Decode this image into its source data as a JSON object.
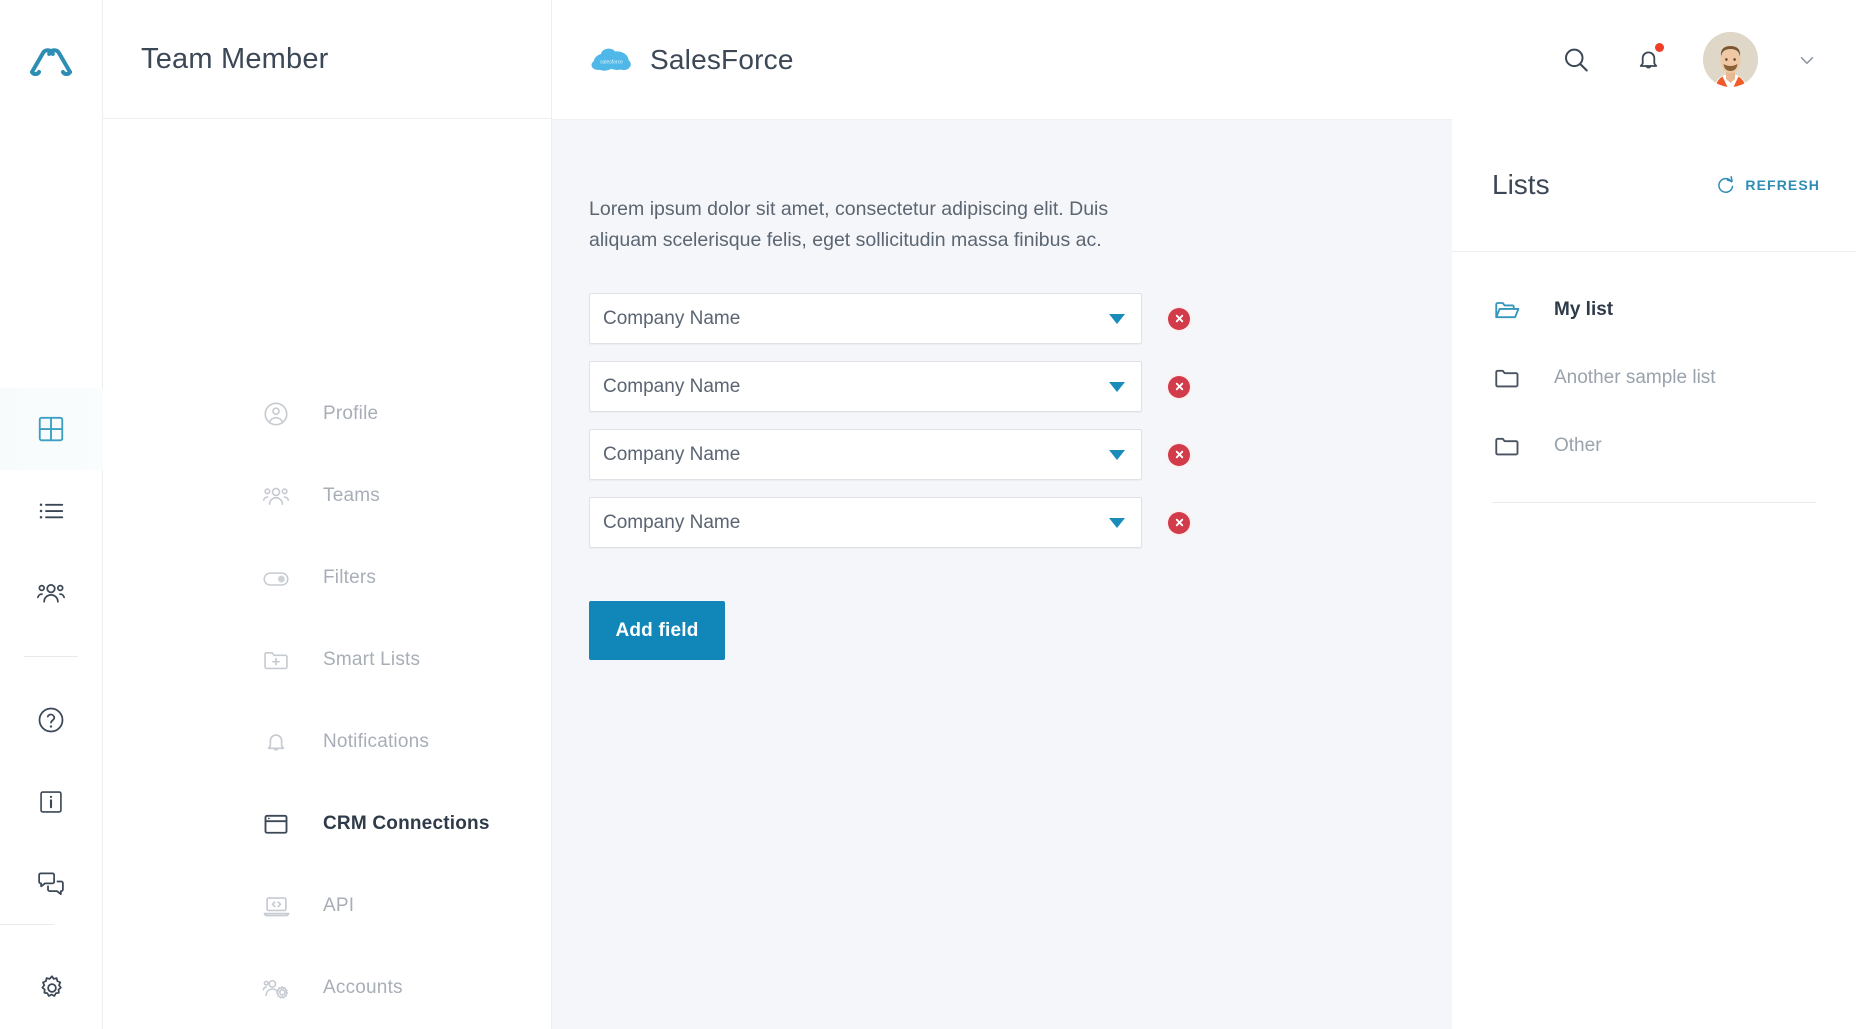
{
  "rail": {
    "logo_icon": "brand-logo-icon",
    "items": [
      {
        "icon": "grid-icon",
        "name": "grid",
        "active": true
      },
      {
        "icon": "list-icon",
        "name": "list",
        "active": false
      },
      {
        "icon": "people-icon",
        "name": "people",
        "active": false
      }
    ],
    "bottom_items": [
      {
        "icon": "help-circle-icon",
        "name": "help",
        "active": false
      },
      {
        "icon": "info-square-icon",
        "name": "info",
        "active": false
      },
      {
        "icon": "chat-bubbles-icon",
        "name": "chat",
        "active": false
      },
      {
        "icon": "gear-icon",
        "name": "settings",
        "active": false
      }
    ]
  },
  "sidebar": {
    "title": "Team Member",
    "items": [
      {
        "label": "Profile",
        "icon": "user-circle-icon",
        "active": false
      },
      {
        "label": "Teams",
        "icon": "group-icon",
        "active": false
      },
      {
        "label": "Filters",
        "icon": "toggle-icon",
        "active": false
      },
      {
        "label": "Smart Lists",
        "icon": "folder-plus-icon",
        "active": false
      },
      {
        "label": "Notifications",
        "icon": "bell-icon",
        "active": false
      },
      {
        "label": "CRM Connections",
        "icon": "browser-window-icon",
        "active": true
      },
      {
        "label": "API",
        "icon": "laptop-code-icon",
        "active": false
      },
      {
        "label": "Accounts",
        "icon": "people-gear-icon",
        "active": false
      }
    ]
  },
  "topbar": {
    "brand_name": "SalesForce",
    "brand_icon": "salesforce-cloud-icon",
    "brand_color": "#4FB8E8",
    "search_icon": "search-icon",
    "notifications_icon": "bell-icon",
    "has_notification_dot": true,
    "notification_dot_color": "#ef3f28",
    "avatar_icon": "avatar",
    "caret_icon": "chevron-down-icon"
  },
  "content": {
    "description": "Lorem ipsum dolor sit amet, consectetur adipiscing elit. Duis aliquam scelerisque felis, eget sollicitudin massa finibus ac.",
    "fields": [
      {
        "value": "Company Name",
        "remove_label": "remove-field"
      },
      {
        "value": "Company Name",
        "remove_label": "remove-field"
      },
      {
        "value": "Company Name",
        "remove_label": "remove-field"
      },
      {
        "value": "Company Name",
        "remove_label": "remove-field"
      }
    ],
    "add_field_label": "Add field",
    "add_field_color": "#1186B8",
    "dropdown_caret_color": "#1A8CBA",
    "remove_button_color": "#D23B4A"
  },
  "lists_panel": {
    "title": "Lists",
    "refresh_label": "REFRESH",
    "refresh_icon": "refresh-icon",
    "refresh_color": "#2E8CB5",
    "items": [
      {
        "label": "My list",
        "icon": "folder-open-icon",
        "active": true
      },
      {
        "label": "Another sample list",
        "icon": "folder-icon",
        "active": false
      },
      {
        "label": "Other",
        "icon": "folder-icon",
        "active": false
      }
    ]
  }
}
